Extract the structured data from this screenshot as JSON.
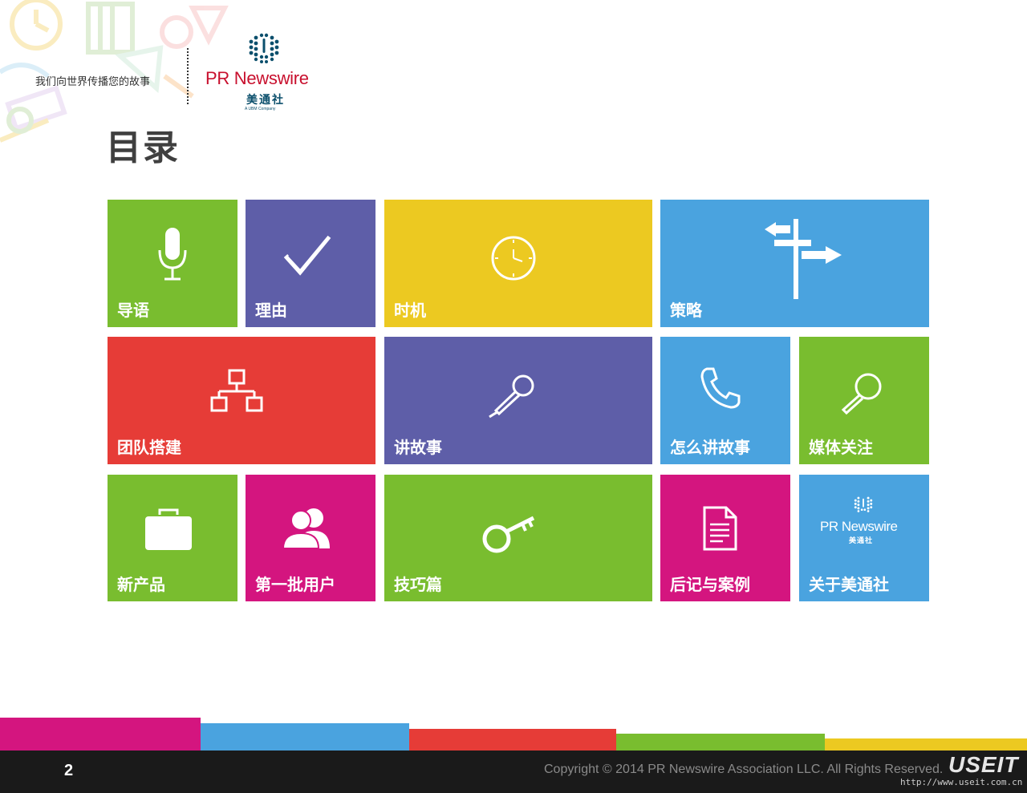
{
  "header": {
    "tagline": "我们向世界传播您的故事",
    "logo_text": "PR Newswire",
    "logo_sub": "美通社",
    "logo_ubm": "A UBM Company"
  },
  "title": "目录",
  "tiles": [
    {
      "label": "导语",
      "icon": "microphone-icon",
      "color": "#79bd2f"
    },
    {
      "label": "理由",
      "icon": "checkmark-icon",
      "color": "#5e5ea8"
    },
    {
      "label": "时机",
      "icon": "clock-icon",
      "color": "#ecc921"
    },
    {
      "label": "策略",
      "icon": "signpost-icon",
      "color": "#4aa3df"
    },
    {
      "label": "团队搭建",
      "icon": "org-chart-icon",
      "color": "#e63c37"
    },
    {
      "label": "讲故事",
      "icon": "handheld-microphone-icon",
      "color": "#5e5ea8"
    },
    {
      "label": "怎么讲故事",
      "icon": "phone-icon",
      "color": "#4aa3df"
    },
    {
      "label": "媒体关注",
      "icon": "magnifier-icon",
      "color": "#79bd2f"
    },
    {
      "label": "新产品",
      "icon": "briefcase-icon",
      "color": "#79bd2f"
    },
    {
      "label": "第一批用户",
      "icon": "users-icon",
      "color": "#d4157f"
    },
    {
      "label": "技巧篇",
      "icon": "key-icon",
      "color": "#79bd2f"
    },
    {
      "label": "后记与案例",
      "icon": "document-icon",
      "color": "#d4157f"
    },
    {
      "label": "关于美通社",
      "icon": "prnewswire-logo-icon",
      "color": "#4aa3df",
      "logo_text": "PR Newswire",
      "logo_sub": "美通社"
    }
  ],
  "footer": {
    "page_number": "2",
    "copyright": "Copyright © 2014 PR Newswire Association LLC. All Rights Reserved.",
    "watermark": "USEIT",
    "watermark_url": "http://www.useit.com.cn"
  },
  "colors": {
    "green": "#79bd2f",
    "purple": "#5e5ea8",
    "yellow": "#ecc921",
    "blue": "#4aa3df",
    "red": "#e63c37",
    "magenta": "#d4157f",
    "footer_bg": "#1a1a1a",
    "logo_red": "#c8102e"
  }
}
